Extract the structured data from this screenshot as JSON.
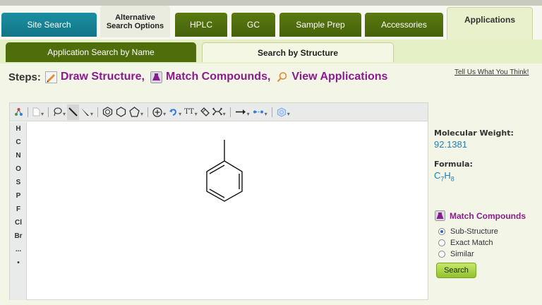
{
  "nav": {
    "site_search": "Site Search",
    "alt_line1": "Alternative",
    "alt_line2": "Search Options",
    "hplc": "HPLC",
    "gc": "GC",
    "sample_prep": "Sample Prep",
    "accessories": "Accessories",
    "applications": "Applications"
  },
  "subnav": {
    "by_name": "Application Search by Name",
    "by_structure": "Search by Structure"
  },
  "steps": {
    "label": "Steps:",
    "draw": "Draw Structure,",
    "match": "Match Compounds,",
    "view": "View Applications"
  },
  "feedback_link": "Tell Us What You Think!",
  "toolbar": {
    "icons": [
      "atom-map-icon",
      "new-document-icon",
      "lasso-select-icon",
      "single-bond-icon",
      "bond-type-icon",
      "benzene-ring-icon",
      "cyclohexane-icon",
      "cyclopentane-icon",
      "charge-plus-icon",
      "undo-icon",
      "text-tool-icon",
      "eraser-icon",
      "template-icon",
      "arrow-icon",
      "reaction-arrow-icon",
      "ring-settings-icon"
    ]
  },
  "elements": [
    "H",
    "C",
    "N",
    "O",
    "S",
    "P",
    "F",
    "Cl",
    "Br",
    "...",
    "•"
  ],
  "properties": {
    "mw_label": "Molecular Weight:",
    "mw_value": "92.1381",
    "formula_label": "Formula:",
    "formula_c": "C",
    "formula_c_n": "7",
    "formula_h": "H",
    "formula_h_n": "8"
  },
  "match": {
    "title": "Match Compounds",
    "options": [
      "Sub-Structure",
      "Exact Match",
      "Similar"
    ],
    "selected": "Sub-Structure",
    "search_button": "Search"
  },
  "colors": {
    "teal_tab": "#1b8fa3",
    "green_tab": "#506d0c",
    "purple_accent": "#8a1c8e",
    "link_blue": "#1f7fb8"
  }
}
